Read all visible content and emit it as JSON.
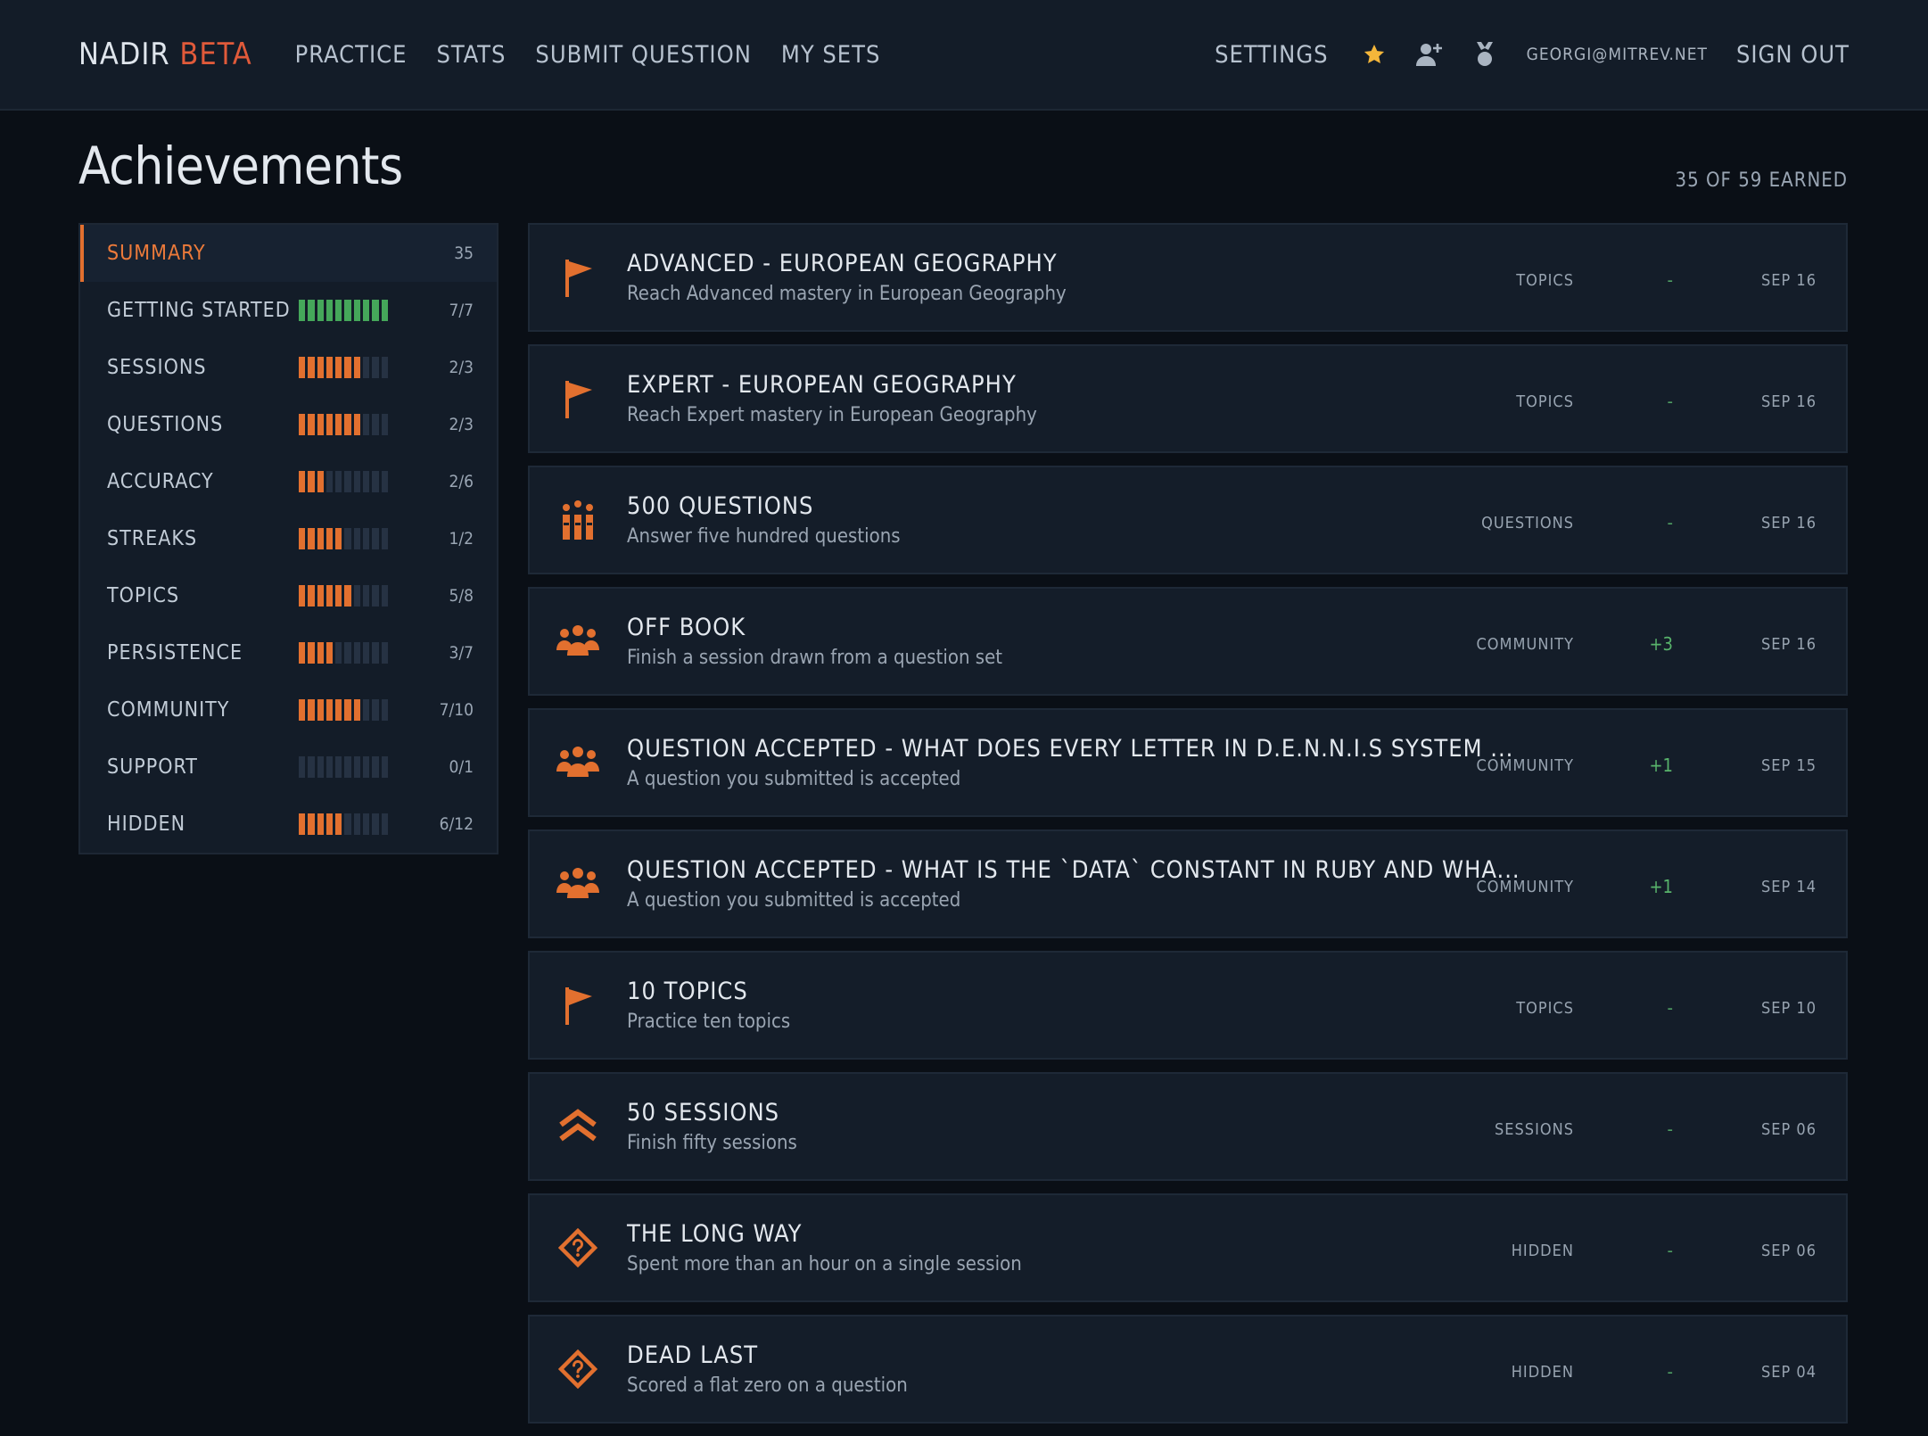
{
  "nav": {
    "brand": "NADIR",
    "brand_tag": "BETA",
    "links": [
      "PRACTICE",
      "STATS",
      "SUBMIT QUESTION",
      "MY SETS"
    ],
    "settings": "SETTINGS",
    "email": "GEORGI@MITREV.NET",
    "sign_out": "SIGN OUT",
    "icons": [
      "star-icon",
      "add-user-icon",
      "medal-icon"
    ],
    "star_color": "#f4b63a"
  },
  "page": {
    "title": "Achievements",
    "earned": "35 OF 59 EARNED"
  },
  "sidebar": {
    "items": [
      {
        "label": "SUMMARY",
        "count": "35",
        "active": true
      },
      {
        "label": "GETTING STARTED",
        "count": "7/7",
        "filled": 10,
        "color": "green"
      },
      {
        "label": "SESSIONS",
        "count": "2/3",
        "filled": 7
      },
      {
        "label": "QUESTIONS",
        "count": "2/3",
        "filled": 7
      },
      {
        "label": "ACCURACY",
        "count": "2/6",
        "filled": 3
      },
      {
        "label": "STREAKS",
        "count": "1/2",
        "filled": 5
      },
      {
        "label": "TOPICS",
        "count": "5/8",
        "filled": 6
      },
      {
        "label": "PERSISTENCE",
        "count": "3/7",
        "filled": 4
      },
      {
        "label": "COMMUNITY",
        "count": "7/10",
        "filled": 7
      },
      {
        "label": "SUPPORT",
        "count": "0/1",
        "filled": 0
      },
      {
        "label": "HIDDEN",
        "count": "6/12",
        "filled": 5
      }
    ],
    "accent": "#e2702f",
    "complete": "#45a75a"
  },
  "achievements": [
    {
      "icon": "flag-icon",
      "title": "ADVANCED - EUROPEAN GEOGRAPHY",
      "desc": "Reach Advanced mastery in European Geography",
      "category": "TOPICS",
      "points": "-",
      "date": "SEP 16"
    },
    {
      "icon": "flag-icon",
      "title": "EXPERT - EUROPEAN GEOGRAPHY",
      "desc": "Reach Expert mastery in European Geography",
      "category": "TOPICS",
      "points": "-",
      "date": "SEP 16"
    },
    {
      "icon": "books-icon",
      "title": "500 QUESTIONS",
      "desc": "Answer five hundred questions",
      "category": "QUESTIONS",
      "points": "-",
      "date": "SEP 16"
    },
    {
      "icon": "group-icon",
      "title": "OFF BOOK",
      "desc": "Finish a session drawn from a question set",
      "category": "COMMUNITY",
      "points": "+3",
      "date": "SEP 16"
    },
    {
      "icon": "group-icon",
      "title": "QUESTION ACCEPTED - WHAT DOES EVERY LETTER IN D.E.N.N.I.S SYSTEM ...",
      "desc": "A question you submitted is accepted",
      "category": "COMMUNITY",
      "points": "+1",
      "date": "SEP 15"
    },
    {
      "icon": "group-icon",
      "title": "QUESTION ACCEPTED - WHAT IS THE `DATA` CONSTANT IN RUBY AND WHA...",
      "desc": "A question you submitted is accepted",
      "category": "COMMUNITY",
      "points": "+1",
      "date": "SEP 14"
    },
    {
      "icon": "flag-icon",
      "title": "10 TOPICS",
      "desc": "Practice ten topics",
      "category": "TOPICS",
      "points": "-",
      "date": "SEP 10"
    },
    {
      "icon": "chevrons-up-icon",
      "title": "50 SESSIONS",
      "desc": "Finish fifty sessions",
      "category": "SESSIONS",
      "points": "-",
      "date": "SEP 06"
    },
    {
      "icon": "mystery-icon",
      "title": "THE LONG WAY",
      "desc": "Spent more than an hour on a single session",
      "category": "HIDDEN",
      "points": "-",
      "date": "SEP 06"
    },
    {
      "icon": "mystery-icon",
      "title": "DEAD LAST",
      "desc": "Scored a flat zero on a question",
      "category": "HIDDEN",
      "points": "-",
      "date": "SEP 04"
    }
  ]
}
